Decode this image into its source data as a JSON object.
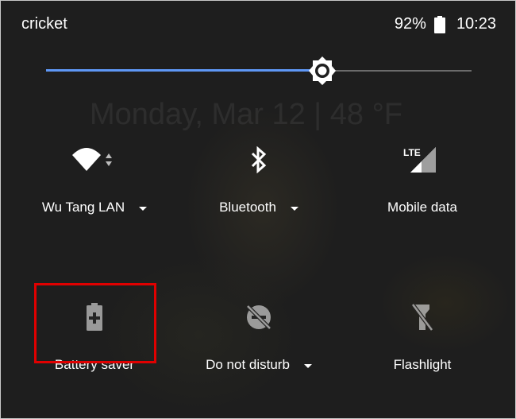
{
  "status_bar": {
    "carrier": "cricket",
    "battery_percent": "92%",
    "time": "10:23"
  },
  "brightness": {
    "level": 0.65
  },
  "lockscreen_ghost": "Monday, Mar 12  |  48 °F",
  "tiles": [
    {
      "label": "Wu Tang LAN",
      "icon": "wifi-icon",
      "has_dropdown": true
    },
    {
      "label": "Bluetooth",
      "icon": "bluetooth-icon",
      "has_dropdown": true
    },
    {
      "label": "Mobile data",
      "icon": "lte-signal-icon",
      "has_dropdown": false
    },
    {
      "label": "Battery saver",
      "icon": "battery-saver-icon",
      "has_dropdown": false
    },
    {
      "label": "Do not disturb",
      "icon": "do-not-disturb-off-icon",
      "has_dropdown": true
    },
    {
      "label": "Flashlight",
      "icon": "flashlight-off-icon",
      "has_dropdown": false
    }
  ],
  "colors": {
    "accent": "#5e97f6",
    "highlight_box": "#e00000"
  }
}
